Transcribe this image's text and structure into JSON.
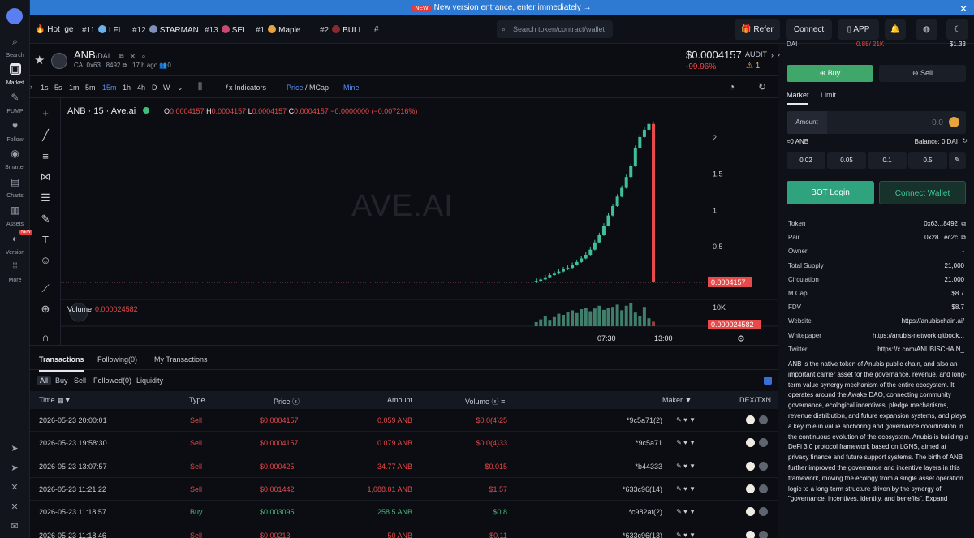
{
  "banner": {
    "tag": "NEW",
    "text": "New version entrance, enter immediately →"
  },
  "nav": {
    "items": [
      {
        "label": "Search",
        "icon": "search-icon"
      },
      {
        "label": "Market",
        "icon": "market-icon"
      },
      {
        "label": "PUMP",
        "icon": "pump-icon"
      },
      {
        "label": "Follow",
        "icon": "heart-icon"
      },
      {
        "label": "Smarter",
        "icon": "smarter-icon"
      },
      {
        "label": "Charts",
        "icon": "charts-icon"
      },
      {
        "label": "Assets",
        "icon": "assets-icon"
      },
      {
        "label": "Version",
        "icon": "version-icon"
      },
      {
        "label": "More",
        "icon": "more-icon"
      }
    ],
    "new_tag": "NEW"
  },
  "topbar": {
    "hot_label": "Hot",
    "tickers": [
      {
        "rank": "",
        "name": "ge"
      },
      {
        "rank": "#11",
        "name": "LFI"
      },
      {
        "rank": "#12",
        "name": "STARMAN"
      },
      {
        "rank": "#13",
        "name": "SEI"
      },
      {
        "rank": "#1",
        "name": "Maple"
      },
      {
        "rank": "#2",
        "name": "BULL"
      },
      {
        "rank": "#",
        "name": ""
      }
    ],
    "search_placeholder": "Search token/contract/wallet",
    "refer": "Refer",
    "connect": "Connect",
    "app": "APP"
  },
  "token": {
    "symbol": "ANB",
    "pair": "/DAI",
    "ca_label": "CA: 0x63...8492",
    "age": "17 h ago",
    "holders": "0",
    "price": "$0.0004157",
    "change": "-99.96%",
    "audit": "AUDIT",
    "audit_count": "1"
  },
  "chart_toolbar": {
    "timeframes": [
      "1s",
      "5s",
      "1m",
      "5m",
      "15m",
      "1h",
      "4h",
      "D",
      "W"
    ],
    "selected": "15m",
    "indicators": "Indicators",
    "price_mcap_a": "Price",
    "price_mcap_b": "/ MCap",
    "mine": "Mine"
  },
  "chart": {
    "legend": "ANB · 15 · Ave.ai",
    "o": "0.0004157",
    "h": "0.0004157",
    "l": "0.0004157",
    "c": "0.0004157",
    "chg": "−0.0000000 (−0.007216%)",
    "watermark": "AVE.AI",
    "price_label": "0.0004157",
    "volume_label": "Volume",
    "volume_value": "0.000024582",
    "volume_axis": "10K",
    "volume_tag": "0.000024582",
    "time_labels": [
      "07:30",
      "13:00"
    ]
  },
  "chart_data": {
    "type": "candlestick",
    "ylim": [
      0,
      2.2
    ],
    "y_ticks": [
      "2",
      "1.5",
      "1",
      "0.5"
    ],
    "closes": [
      0.02,
      0.04,
      0.07,
      0.1,
      0.12,
      0.15,
      0.18,
      0.2,
      0.24,
      0.28,
      0.33,
      0.38,
      0.45,
      0.55,
      0.65,
      0.78,
      0.92,
      1.05,
      1.18,
      1.3,
      1.45,
      1.6,
      1.85,
      2.0,
      2.1,
      2.18,
      0.0004157
    ],
    "volumes": [
      0.18,
      0.3,
      0.45,
      0.28,
      0.4,
      0.55,
      0.5,
      0.62,
      0.7,
      0.58,
      0.75,
      0.8,
      0.66,
      0.78,
      0.9,
      0.72,
      0.8,
      0.85,
      0.95,
      0.7,
      0.9,
      1.0,
      0.6,
      0.45,
      0.85,
      0.35,
      0.2
    ],
    "last_price": 0.0004157
  },
  "tx_tabs": [
    "Transactions",
    "Following(0)",
    "My Transactions"
  ],
  "filters": [
    "All",
    "Buy",
    "Sell",
    "Followed(0)",
    "Liquidity"
  ],
  "table": {
    "headers": {
      "time": "Time",
      "type": "Type",
      "price": "Price",
      "amount": "Amount",
      "volume": "Volume",
      "maker": "Maker",
      "dex": "DEX/TXN"
    },
    "rows": [
      {
        "time": "2026-05-23 20:00:01",
        "type": "Sell",
        "price": "$0.0004157",
        "amount": "0.059 ANB",
        "volume": "$0.0(4)25",
        "maker": "*9c5a71(2)"
      },
      {
        "time": "2026-05-23 19:58:30",
        "type": "Sell",
        "price": "$0.0004157",
        "amount": "0.079 ANB",
        "volume": "$0.0(4)33",
        "maker": "*9c5a71"
      },
      {
        "time": "2026-05-23 13:07:57",
        "type": "Sell",
        "price": "$0.000425",
        "amount": "34.77 ANB",
        "volume": "$0.015",
        "maker": "*b44333"
      },
      {
        "time": "2026-05-23 11:21:22",
        "type": "Sell",
        "price": "$0.001442",
        "amount": "1,088.01 ANB",
        "volume": "$1.57",
        "maker": "*633c96(14)"
      },
      {
        "time": "2026-05-23 11:18:57",
        "type": "Buy",
        "price": "$0.003095",
        "amount": "258.5 ANB",
        "volume": "$0.8",
        "maker": "*c982af(2)"
      },
      {
        "time": "2026-05-23 11:18:46",
        "type": "Sell",
        "price": "$0.00213",
        "amount": "50 ANB",
        "volume": "$0.11",
        "maker": "*633c96(13)"
      }
    ]
  },
  "panel": {
    "top_left": "DAI",
    "top_mid": "0.88/ 21K",
    "top_right": "$1.33",
    "buy": "Buy",
    "sell": "Sell",
    "market": "Market",
    "limit": "Limit",
    "amount_label": "Amount",
    "amount_value": "0.0",
    "approx": "≈0 ANB",
    "balance": "Balance: 0 DAI",
    "presets": [
      "0.02",
      "0.05",
      "0.1",
      "0.5"
    ],
    "bot_login": "BOT Login",
    "connect_wallet": "Connect Wallet",
    "info": [
      {
        "k": "Token",
        "v": "0x63...8492"
      },
      {
        "k": "Pair",
        "v": "0x28...ec2c"
      },
      {
        "k": "Owner",
        "v": "-"
      },
      {
        "k": "Total Supply",
        "v": "21,000"
      },
      {
        "k": "Circulation",
        "v": "21,000"
      },
      {
        "k": "M.Cap",
        "v": "$8.7"
      },
      {
        "k": "FDV",
        "v": "$8.7"
      },
      {
        "k": "Website",
        "v": "https://anubischain.ai/"
      },
      {
        "k": "Whitepaper",
        "v": "https://anubis-network.qitbook..."
      },
      {
        "k": "Twitter",
        "v": "https://x.com/ANUBISCHAIN_"
      }
    ],
    "description": "ANB is the native token of Anubis public chain, and also an important carrier asset for the governance, revenue, and long-term value synergy mechanism of the entire ecosystem. It operates around the Awake DAO, connecting community governance, ecological incentives, pledge mechanisms, revenue distribution, and future expansion systems, and plays a key role in value anchoring and governance coordination in the continuous evolution of the ecosystem. Anubis is building a DeFi 3.0 protocol framework based on LGNS, aimed at privacy finance and future support systems. The birth of ANB further improved the governance and incentive layers in this framework, moving the ecology from a single asset operation logic to a long-term structure driven by the synergy of \"governance, incentives, identity, and benefits\". Expand"
  }
}
